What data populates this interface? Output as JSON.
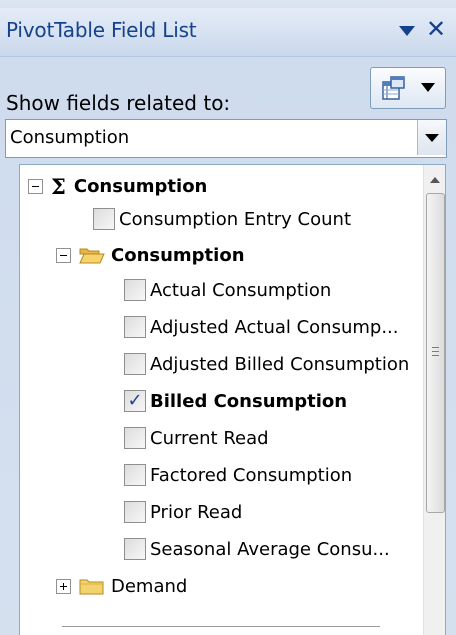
{
  "header": {
    "title": "PivotTable Field List",
    "menu_icon": "dropdown-arrow-icon",
    "close_icon": "close-x-icon",
    "close_glyph": "✕"
  },
  "filter": {
    "label": "Show fields related to:",
    "layout_button_icon": "field-list-layout-icon",
    "combo_value": "Consumption"
  },
  "tree": {
    "measure_group": {
      "label": "Consumption",
      "symbol": "Σ"
    },
    "entry_count": {
      "label": "Consumption Entry Count",
      "checked": false
    },
    "folder": {
      "label": "Consumption"
    },
    "fields": [
      {
        "label": "Actual Consumption",
        "checked": false
      },
      {
        "label": "Adjusted Actual Consump...",
        "checked": false
      },
      {
        "label": "Adjusted Billed Consumption",
        "checked": false
      },
      {
        "label": "Billed Consumption",
        "checked": true,
        "check_glyph": "✓"
      },
      {
        "label": "Current Read",
        "checked": false
      },
      {
        "label": "Factored Consumption",
        "checked": false
      },
      {
        "label": "Prior Read",
        "checked": false
      },
      {
        "label": "Seasonal Average Consu...",
        "checked": false
      }
    ],
    "collapsed_folder": {
      "label": "Demand"
    }
  },
  "colors": {
    "title_text": "#15428b",
    "panel_bg": "#d5e0ef",
    "folder_yellow": "#f3d36e",
    "checkmark": "#21409a"
  }
}
